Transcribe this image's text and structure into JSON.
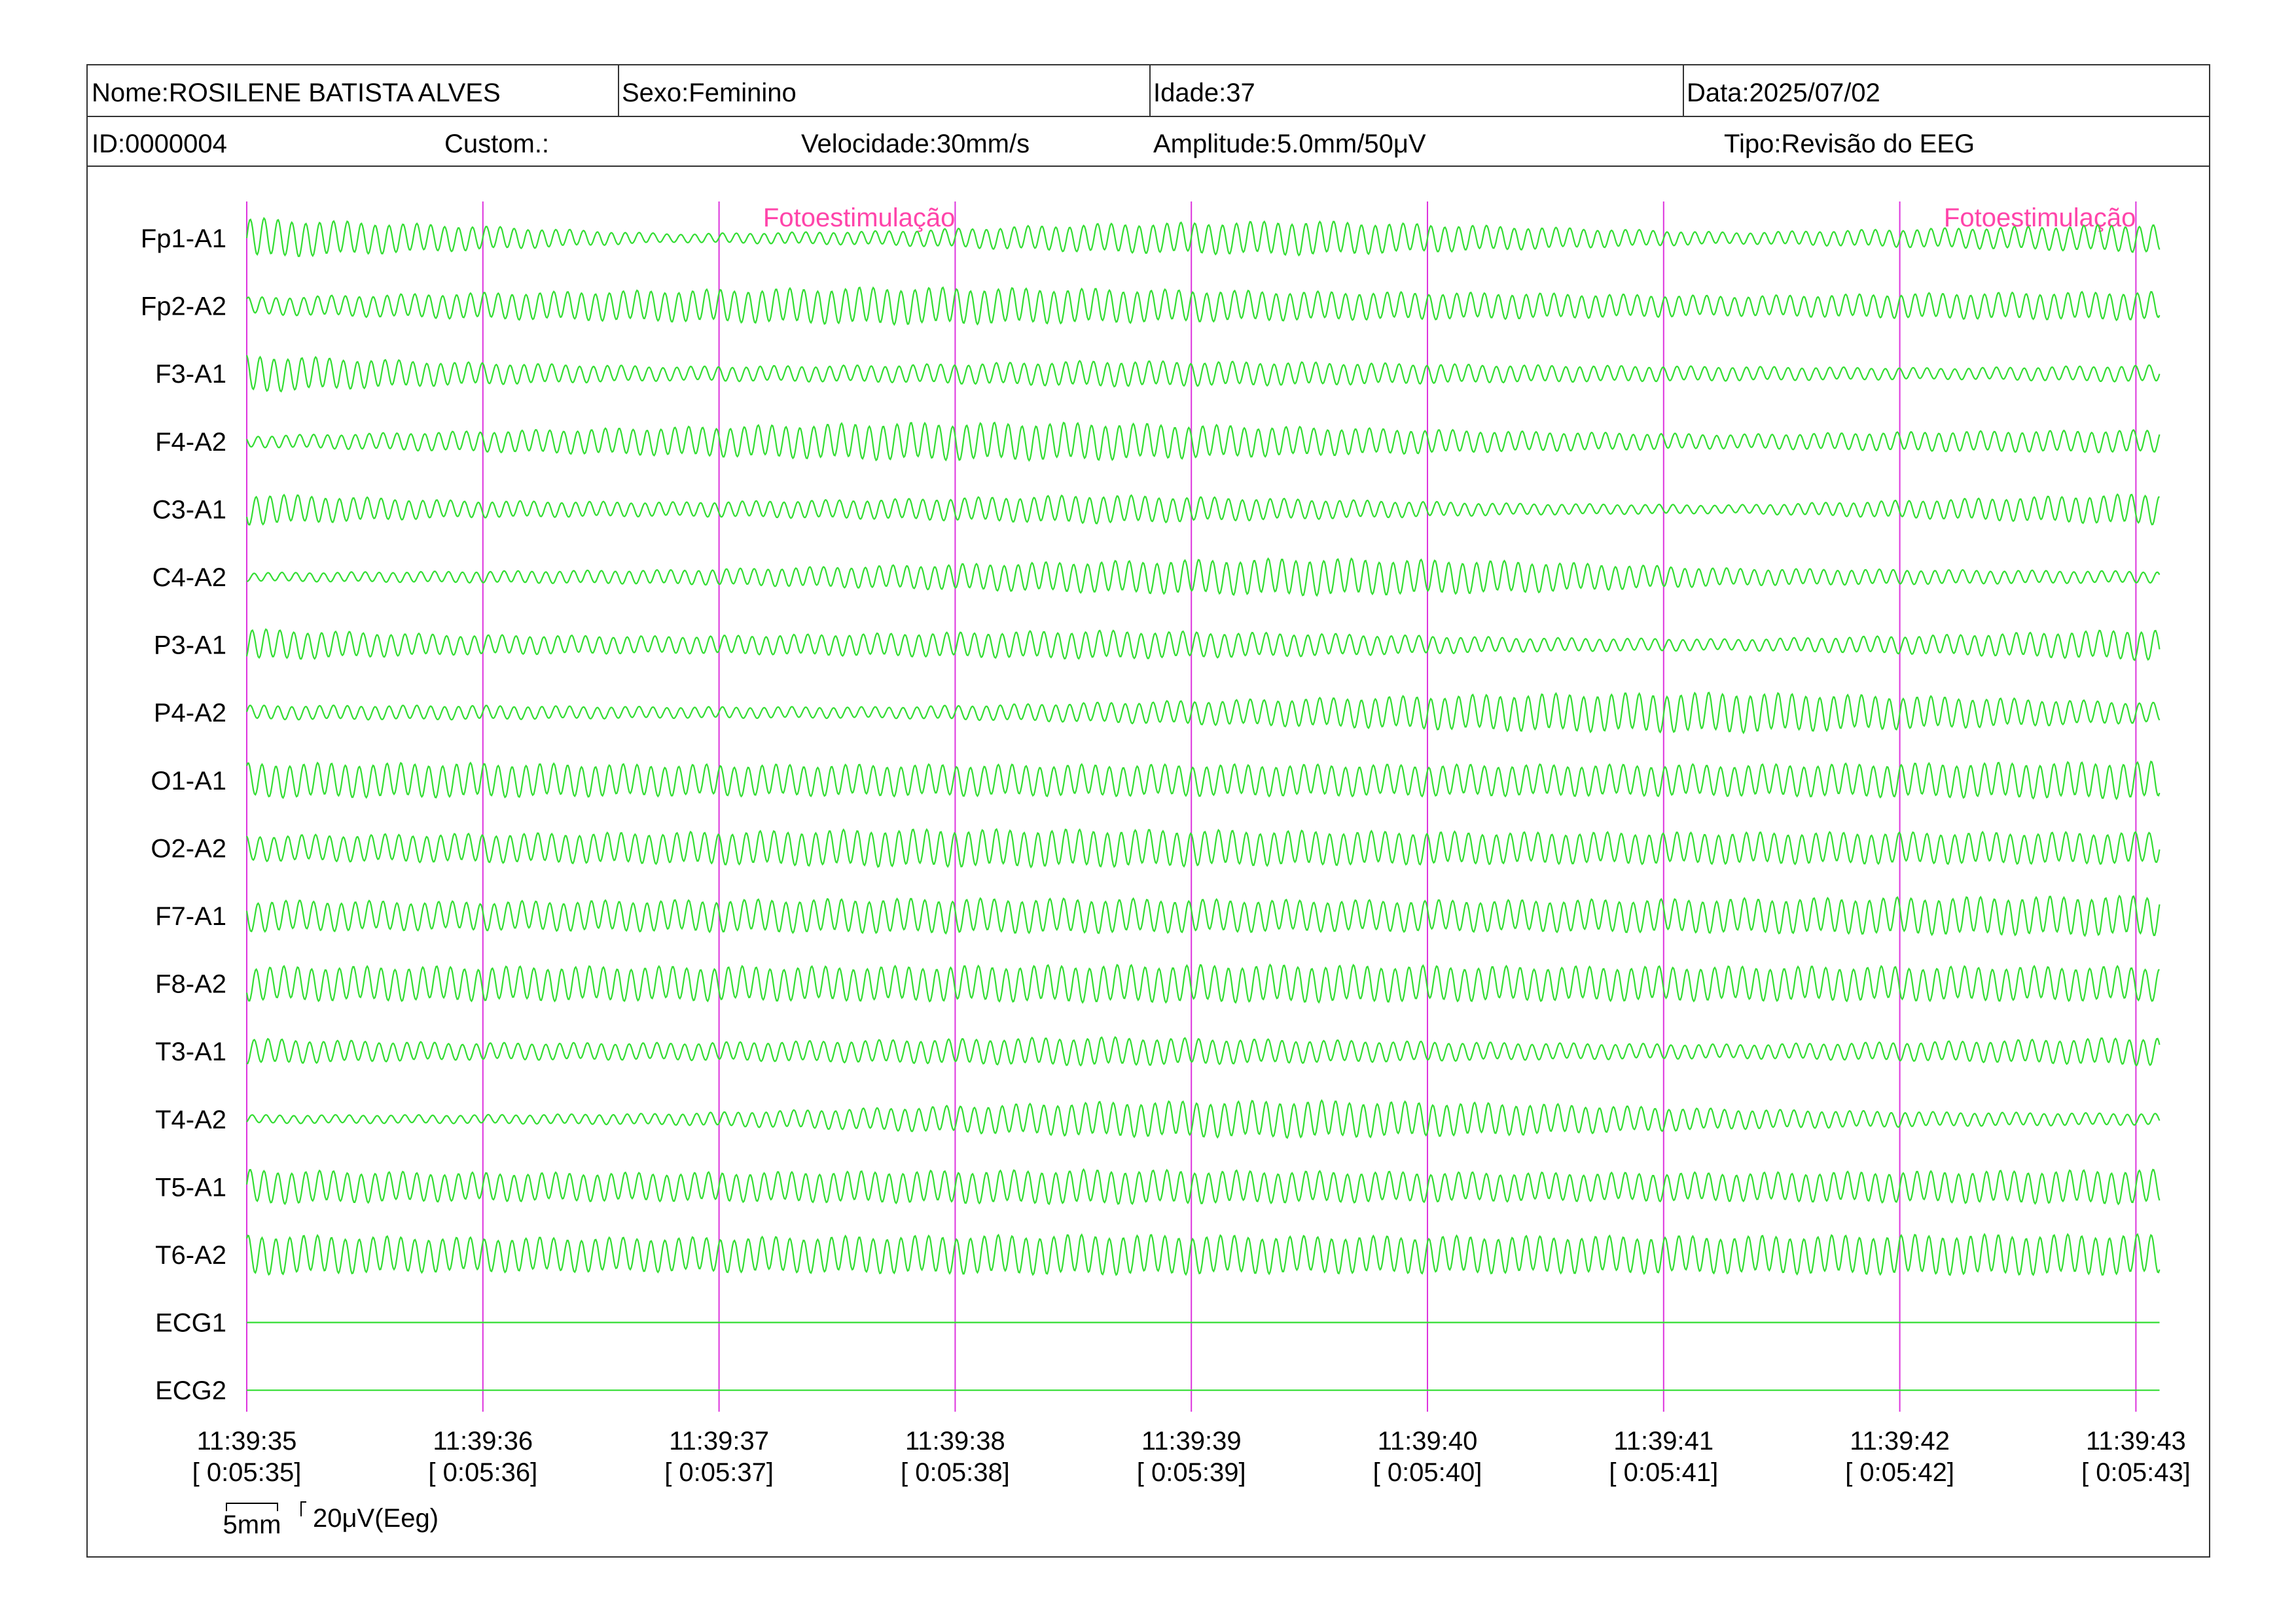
{
  "header": {
    "nome": "Nome:ROSILENE BATISTA ALVES",
    "sexo": "Sexo:Feminino",
    "idade": "Idade:37",
    "data": "Data:2025/07/02",
    "id": "ID:0000004",
    "custom": "Custom.:",
    "velocidade": "Velocidade:30mm/s",
    "amplitude": "Amplitude:5.0mm/50μV",
    "tipo": "Tipo:Revisão do EEG"
  },
  "chart_data": {
    "type": "line",
    "title": "",
    "x_unit": "s",
    "xlim": [
      0,
      8.1
    ],
    "time_ticks": [
      {
        "clock": "11:39:35",
        "elapsed": "[ 0:05:35]"
      },
      {
        "clock": "11:39:36",
        "elapsed": "[ 0:05:36]"
      },
      {
        "clock": "11:39:37",
        "elapsed": "[ 0:05:37]"
      },
      {
        "clock": "11:39:38",
        "elapsed": "[ 0:05:38]"
      },
      {
        "clock": "11:39:39",
        "elapsed": "[ 0:05:39]"
      },
      {
        "clock": "11:39:40",
        "elapsed": "[ 0:05:40]"
      },
      {
        "clock": "11:39:41",
        "elapsed": "[ 0:05:41]"
      },
      {
        "clock": "11:39:42",
        "elapsed": "[ 0:05:42]"
      },
      {
        "clock": "11:39:43",
        "elapsed": "[ 0:05:43]"
      }
    ],
    "events": [
      {
        "label": "Fotoestimulação",
        "time": 3.0
      },
      {
        "label": "Fotoestimulação",
        "time": 8.0
      }
    ],
    "scale_bar": {
      "time": "5mm",
      "amplitude": "20μV(Eeg)"
    },
    "grid": "vertical lines each second",
    "trace_color": "#33dd33",
    "marker_color": "#dd33dd",
    "event_text_color": "#ff44aa",
    "series": [
      {
        "name": "Fp1-A1",
        "freq_hz": 17,
        "amplitude_uv": [
          28,
          18,
          6,
          10,
          20,
          24,
          16,
          8,
          14,
          20
        ]
      },
      {
        "name": "Fp2-A2",
        "freq_hz": 17,
        "amplitude_uv": [
          12,
          18,
          22,
          26,
          24,
          20,
          18,
          14,
          18,
          20
        ]
      },
      {
        "name": "F3-A1",
        "freq_hz": 17,
        "amplitude_uv": [
          26,
          16,
          10,
          12,
          18,
          16,
          12,
          10,
          8,
          12
        ]
      },
      {
        "name": "F4-A2",
        "freq_hz": 17,
        "amplitude_uv": [
          8,
          14,
          20,
          26,
          26,
          20,
          14,
          10,
          14,
          16
        ]
      },
      {
        "name": "C3-A1",
        "freq_hz": 17,
        "amplitude_uv": [
          22,
          12,
          10,
          14,
          20,
          14,
          8,
          6,
          14,
          22
        ]
      },
      {
        "name": "C4-A2",
        "freq_hz": 17,
        "amplitude_uv": [
          6,
          8,
          10,
          16,
          22,
          26,
          22,
          12,
          10,
          8
        ]
      },
      {
        "name": "P3-A1",
        "freq_hz": 17,
        "amplitude_uv": [
          22,
          14,
          12,
          16,
          20,
          16,
          10,
          8,
          14,
          22
        ]
      },
      {
        "name": "P4-A2",
        "freq_hz": 17,
        "amplitude_uv": [
          10,
          10,
          8,
          8,
          14,
          20,
          26,
          28,
          22,
          14
        ]
      },
      {
        "name": "O1-A1",
        "freq_hz": 17,
        "amplitude_uv": [
          24,
          24,
          22,
          22,
          22,
          22,
          22,
          22,
          24,
          26
        ]
      },
      {
        "name": "O2-A2",
        "freq_hz": 17,
        "amplitude_uv": [
          18,
          20,
          22,
          26,
          26,
          24,
          22,
          22,
          22,
          22
        ]
      },
      {
        "name": "F7-A1",
        "freq_hz": 17,
        "amplitude_uv": [
          22,
          20,
          22,
          24,
          24,
          22,
          22,
          24,
          26,
          28
        ]
      },
      {
        "name": "F8-A2",
        "freq_hz": 17,
        "amplitude_uv": [
          24,
          24,
          24,
          24,
          26,
          26,
          24,
          24,
          24,
          24
        ]
      },
      {
        "name": "T3-A1",
        "freq_hz": 17,
        "amplitude_uv": [
          18,
          12,
          12,
          16,
          20,
          16,
          12,
          10,
          14,
          20
        ]
      },
      {
        "name": "T4-A2",
        "freq_hz": 17,
        "amplitude_uv": [
          6,
          6,
          8,
          16,
          24,
          26,
          22,
          14,
          10,
          8
        ]
      },
      {
        "name": "T5-A1",
        "freq_hz": 17,
        "amplitude_uv": [
          24,
          20,
          20,
          22,
          24,
          22,
          20,
          20,
          22,
          24
        ]
      },
      {
        "name": "T6-A2",
        "freq_hz": 17,
        "amplitude_uv": [
          28,
          24,
          24,
          26,
          28,
          26,
          26,
          26,
          28,
          28
        ]
      },
      {
        "name": "ECG1",
        "freq_hz": 0,
        "amplitude_uv": [
          0,
          0,
          0,
          0,
          0,
          0,
          0,
          0,
          0,
          0
        ]
      },
      {
        "name": "ECG2",
        "freq_hz": 0,
        "amplitude_uv": [
          0,
          0,
          0,
          0,
          0,
          0,
          0,
          0,
          0,
          0
        ]
      }
    ]
  }
}
